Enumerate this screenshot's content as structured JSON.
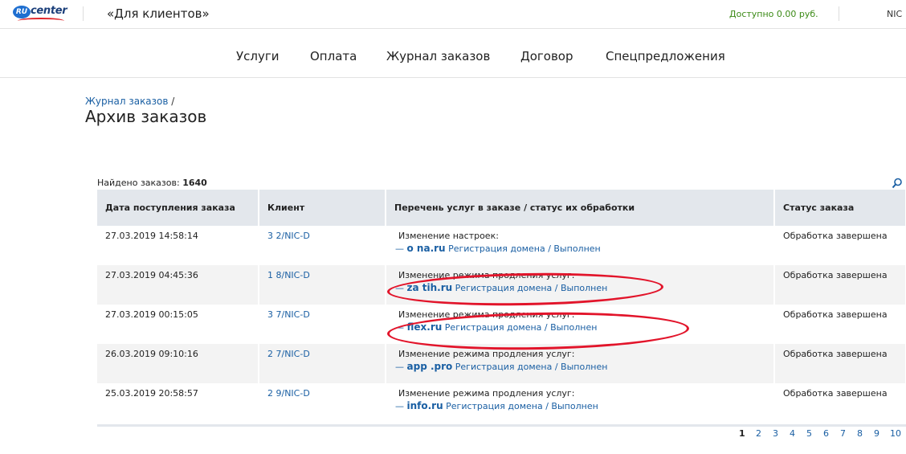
{
  "header": {
    "logo_badge": "RU",
    "logo_text": "center",
    "client_title": "«Для клиентов»",
    "balance": "Доступно 0.00 руб.",
    "nic_short": "NIC"
  },
  "nav": {
    "items": [
      "Услуги",
      "Оплата",
      "Журнал заказов",
      "Договор",
      "Спецпредложения"
    ]
  },
  "breadcrumb": {
    "parent": "Журнал заказов",
    "separator": " /"
  },
  "page": {
    "title": "Архив заказов",
    "found_label": "Найдено заказов:",
    "found_count": "1640"
  },
  "table": {
    "headers": [
      "Дата поступления заказа",
      "Клиент",
      "Перечень услуг в заказе / статус их обработки",
      "Статус заказа"
    ],
    "rows": [
      {
        "date": "27.03.2019 14:58:14",
        "client": "3         2/NIC-D",
        "service_head": "Изменение настроек:",
        "dash": "—",
        "domain": "o          na.ru",
        "service": "Регистрация домена",
        "service_status": "/ Выполнен",
        "status": "Обработка завершена"
      },
      {
        "date": "27.03.2019 04:45:36",
        "client": "1          8/NIC-D",
        "service_head": "Изменение режима продления услуг:",
        "dash": "—",
        "domain": "za         tih.ru",
        "service": "Регистрация домена",
        "service_status": "/ Выполнен",
        "status": "Обработка завершена"
      },
      {
        "date": "27.03.2019 00:15:05",
        "client": "3         7/NIC-D",
        "service_head": "Изменение режима продления услуг:",
        "dash": "—",
        "domain": "          flex.ru",
        "service": "Регистрация домена",
        "service_status": "/ Выполнен",
        "status": "Обработка завершена"
      },
      {
        "date": "26.03.2019 09:10:16",
        "client": "2        7/NIC-D",
        "service_head": "Изменение режима продления услуг:",
        "dash": "—",
        "domain": "app          .pro",
        "service": "Регистрация домена",
        "service_status": "/ Выполнен",
        "status": "Обработка завершена"
      },
      {
        "date": "25.03.2019 20:58:57",
        "client": "2         9/NIC-D",
        "service_head": "Изменение режима продления услуг:",
        "dash": "—",
        "domain": "        info.ru",
        "service": "Регистрация домена",
        "service_status": "/ Выполнен",
        "status": "Обработка завершена"
      }
    ]
  },
  "pagination": {
    "current": "1",
    "pages": [
      "1",
      "2",
      "3",
      "4",
      "5",
      "6",
      "7",
      "8",
      "9",
      "10"
    ]
  },
  "colors": {
    "link": "#1a5fa3",
    "balance": "#3b8a16",
    "header_bg": "#e3e7ec",
    "annotation": "#e2142a"
  }
}
